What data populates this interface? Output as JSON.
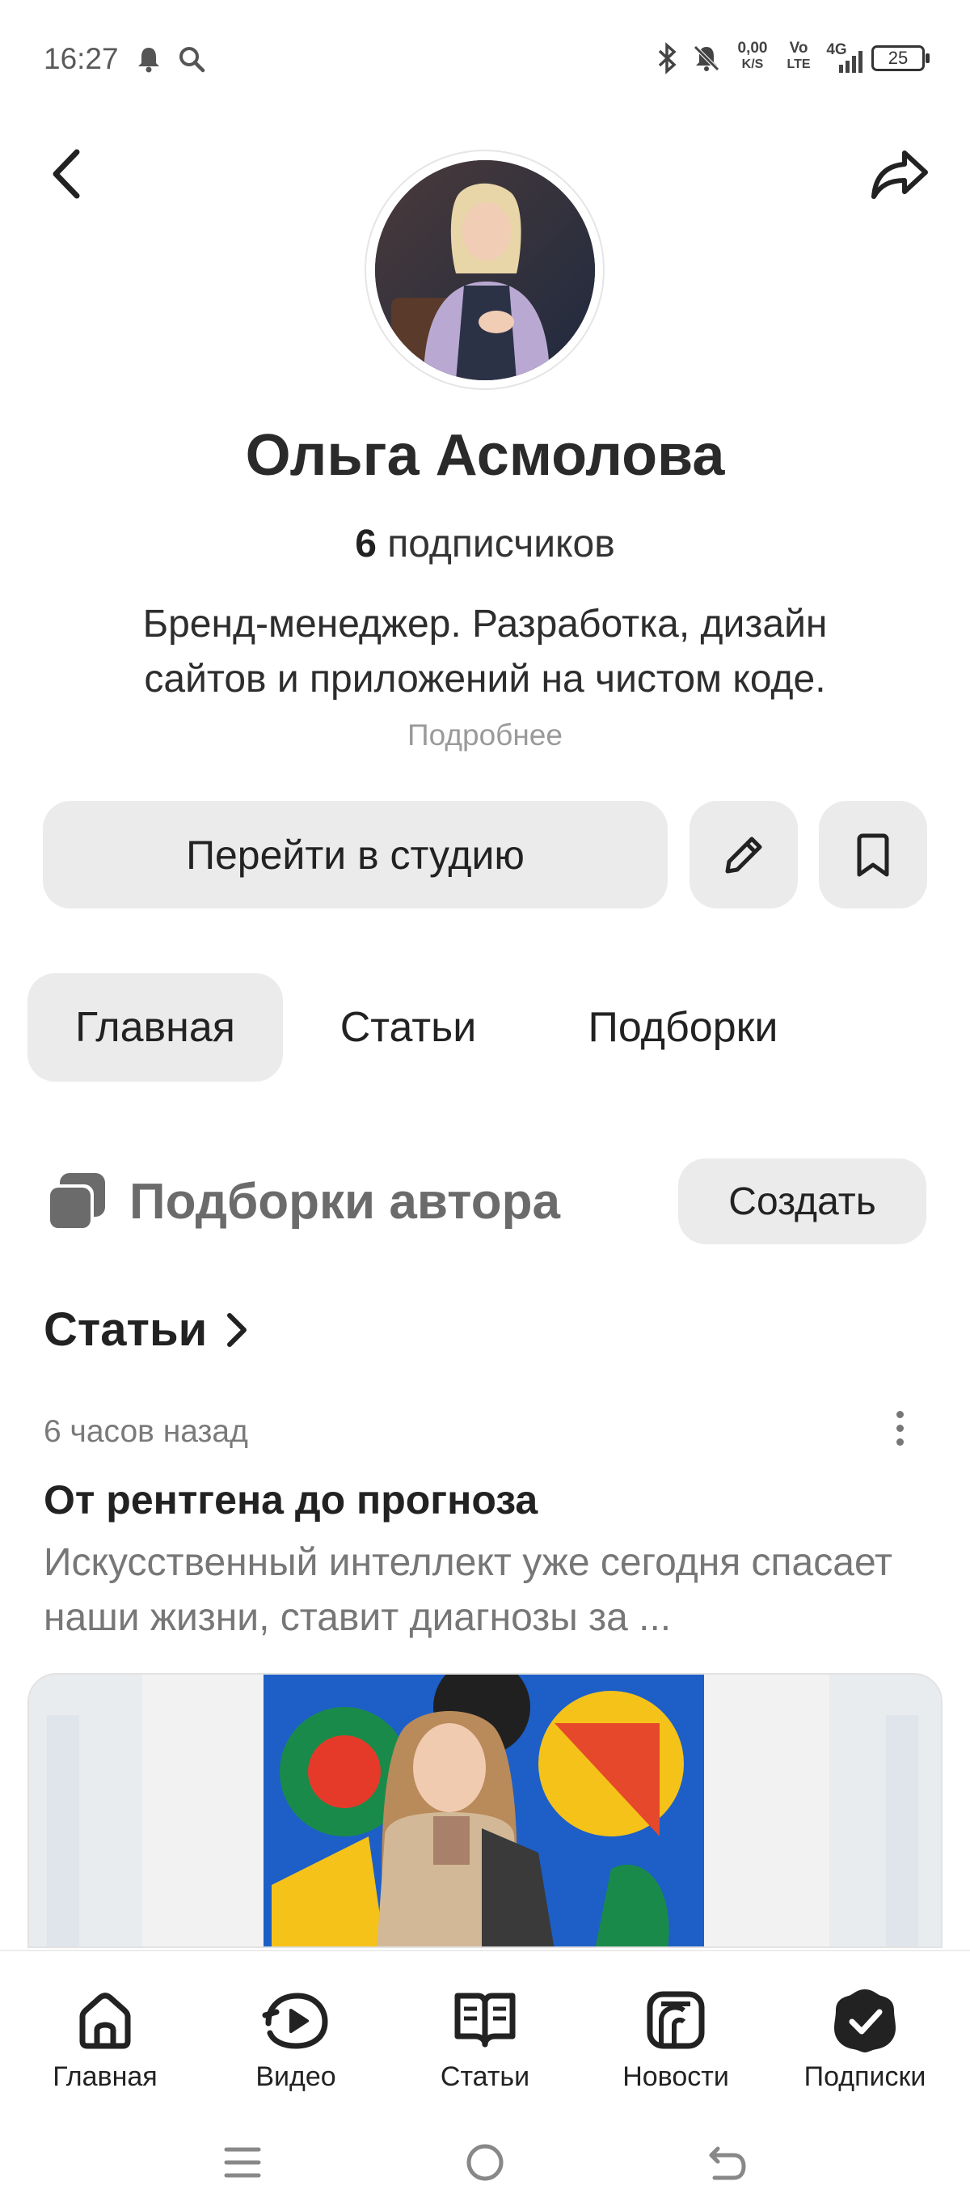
{
  "status_bar": {
    "time": "16:27",
    "net_speed_top": "0,00",
    "net_speed_bottom": "K/S",
    "volte_top": "Vo",
    "volte_bottom": "LTE",
    "network": "4G",
    "battery": "25",
    "icons": [
      "notification-icon",
      "search-icon",
      "bluetooth-icon",
      "mute-icon",
      "signal-icon",
      "battery-icon"
    ]
  },
  "header": {
    "back_icon": "chevron-left-icon",
    "share_icon": "share-icon"
  },
  "profile": {
    "name": "Ольга Асмолова",
    "followers_count": "6",
    "followers_label": "подписчиков",
    "bio": "Бренд-менеджер. Разработка, дизайн сайтов и приложений на чистом коде.",
    "more": "Подробнее"
  },
  "actions": {
    "studio": "Перейти в студию",
    "edit_icon": "pencil-icon",
    "bookmark_icon": "bookmark-icon"
  },
  "tabs": [
    {
      "label": "Главная",
      "active": true
    },
    {
      "label": "Статьи",
      "active": false
    },
    {
      "label": "Подборки",
      "active": false
    }
  ],
  "collections": {
    "title": "Подборки автора",
    "create": "Создать"
  },
  "articles": {
    "heading": "Статьи",
    "items": [
      {
        "time": "6 часов назад",
        "title": "От рентгена до прогноза",
        "excerpt": "Искусственный интеллект уже сегодня спасает наши жизни, ставит диагнозы за ..."
      }
    ]
  },
  "bottom_nav": [
    {
      "label": "Главная",
      "icon": "home-icon"
    },
    {
      "label": "Видео",
      "icon": "video-icon"
    },
    {
      "label": "Статьи",
      "icon": "articles-icon"
    },
    {
      "label": "Новости",
      "icon": "news-icon"
    },
    {
      "label": "Подписки",
      "icon": "subscriptions-icon"
    }
  ],
  "colors": {
    "button_bg": "#ebebeb",
    "text": "#222222",
    "muted": "#9a9a9a"
  }
}
